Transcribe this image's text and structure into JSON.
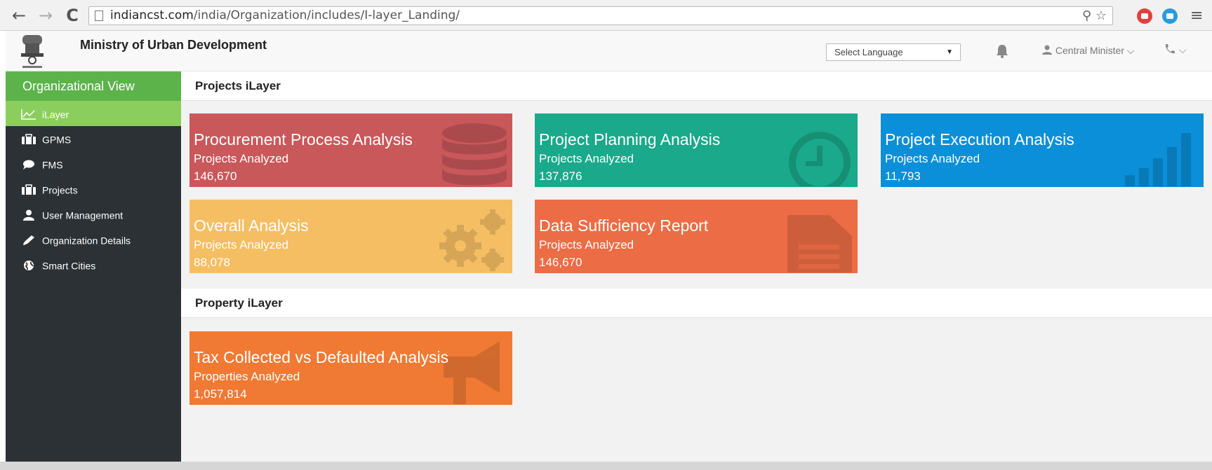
{
  "browser": {
    "url_host": "indiancst.com",
    "url_path": "/india/Organization/includes/I-layer_Landing/"
  },
  "header": {
    "title": "Ministry of Urban Development",
    "language_select": "Select Language",
    "user": "Central Minister"
  },
  "sidebar": {
    "heading": "Organizational View",
    "items": [
      {
        "label": "iLayer",
        "icon": "line-chart-icon"
      },
      {
        "label": "GPMS",
        "icon": "briefcase-icon"
      },
      {
        "label": "FMS",
        "icon": "comment-icon"
      },
      {
        "label": "Projects",
        "icon": "briefcase-icon"
      },
      {
        "label": "User Management",
        "icon": "user-icon"
      },
      {
        "label": "Organization Details",
        "icon": "pencil-icon"
      },
      {
        "label": "Smart Cities",
        "icon": "globe-icon"
      }
    ]
  },
  "sections": {
    "projects": {
      "title": "Projects iLayer",
      "tiles": [
        {
          "title": "Procurement Process Analysis",
          "subtitle": "Projects Analyzed",
          "value": "146,670",
          "color": "#c9585a"
        },
        {
          "title": "Project Planning Analysis",
          "subtitle": "Projects Analyzed",
          "value": "137,876",
          "color": "#1aa98a"
        },
        {
          "title": "Project Execution Analysis",
          "subtitle": "Projects Analyzed",
          "value": "11,793",
          "color": "#0b8fd8"
        },
        {
          "title": "Overall Analysis",
          "subtitle": "Projects Analyzed",
          "value": "88,078",
          "color": "#f5be63"
        },
        {
          "title": "Data Sufficiency Report",
          "subtitle": "Projects Analyzed",
          "value": "146,670",
          "color": "#ec6c45"
        }
      ]
    },
    "property": {
      "title": "Property iLayer",
      "tiles": [
        {
          "title": "Tax Collected vs Defaulted Analysis",
          "subtitle": "Properties Analyzed",
          "value": "1,057,814",
          "color": "#f07a34"
        }
      ]
    }
  }
}
